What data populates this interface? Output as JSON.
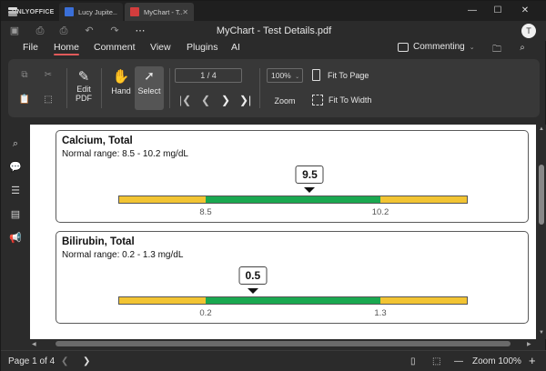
{
  "tabs": {
    "app_logo_label": "ONLYOFFICE",
    "items": [
      {
        "label": "Lucy Jupite..."
      },
      {
        "label": "MyChart - T..."
      }
    ],
    "close_symbol": "✕"
  },
  "window_controls": {
    "minimize": "—",
    "maximize": "☐",
    "close": "✕"
  },
  "title_bar": {
    "document_title": "MyChart - Test Details.pdf",
    "user_initial": "T"
  },
  "menu": {
    "items": [
      "File",
      "Home",
      "Comment",
      "View",
      "Plugins",
      "AI"
    ],
    "active": "Home",
    "mode_label": "Commenting"
  },
  "ribbon": {
    "edit_pdf_label_1": "Edit",
    "edit_pdf_label_2": "PDF",
    "hand_label": "Hand",
    "select_label": "Select",
    "page_indicator": "1 / 4",
    "zoom_value": "100%",
    "zoom_label": "Zoom",
    "fit_page_label": "Fit To Page",
    "fit_width_label": "Fit To Width"
  },
  "document": {
    "results": [
      {
        "title": "Calcium, Total",
        "normal_range": "Normal range: 8.5 - 10.2 mg/dL",
        "value": "9.5",
        "value_position": 0.548,
        "low_tick": "8.5",
        "high_tick": "10.2"
      },
      {
        "title": "Bilirubin, Total",
        "normal_range": "Normal range: 0.2 - 1.3 mg/dL",
        "value": "0.5",
        "value_position": 0.385,
        "low_tick": "0.2",
        "high_tick": "1.3"
      }
    ],
    "colors": {
      "out_of_range": "#f2c433",
      "in_range": "#1aa850"
    }
  },
  "status": {
    "page_info": "Page 1 of 4",
    "zoom_info": "Zoom 100%",
    "zoom_minus": "—",
    "zoom_plus": "+"
  },
  "colors": {
    "accent_underline": "#e05a5a",
    "chrome_bg": "#2b2b2b",
    "ribbon_bg": "#383838"
  }
}
